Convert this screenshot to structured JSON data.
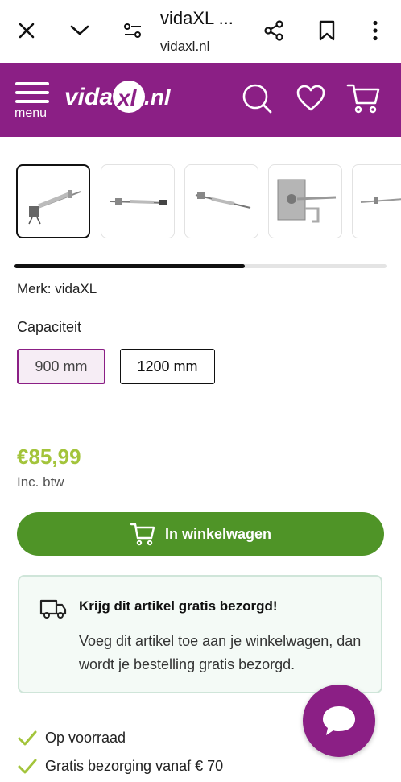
{
  "browser": {
    "title": "vidaXL ...",
    "url": "vidaxl.nl",
    "icons": [
      "close-icon",
      "chevron-down-icon",
      "site-settings-icon",
      "share-icon",
      "bookmark-icon",
      "more-vert-icon"
    ]
  },
  "header": {
    "menu_label": "menu",
    "logo_text": "vidaXL.nl",
    "icons": [
      "search-icon",
      "heart-icon",
      "cart-icon"
    ],
    "brand_color": "#8b1f85"
  },
  "gallery": {
    "thumbnails": [
      "product-image-1",
      "product-image-2",
      "product-image-3",
      "product-image-4",
      "product-image-5"
    ],
    "active_index": 0,
    "scroll_progress": 0.62
  },
  "product": {
    "brand": "Merk: vidaXL",
    "capacity_label": "Capaciteit",
    "options": [
      "900 mm",
      "1200 mm"
    ],
    "selected_option": "900 mm",
    "price": "€85,99",
    "vat_note": "Inc. btw",
    "price_color": "#a3c43b"
  },
  "cart_button": {
    "label": "In winkelwagen",
    "color": "#4f9427"
  },
  "shipping": {
    "title": "Krijg dit artikel gratis bezorgd!",
    "text": "Voeg dit artikel toe aan je winkelwagen, dan wordt je bestelling gratis bezorgd."
  },
  "usps": [
    "Op voorraad",
    "Gratis bezorging vanaf € 70"
  ]
}
